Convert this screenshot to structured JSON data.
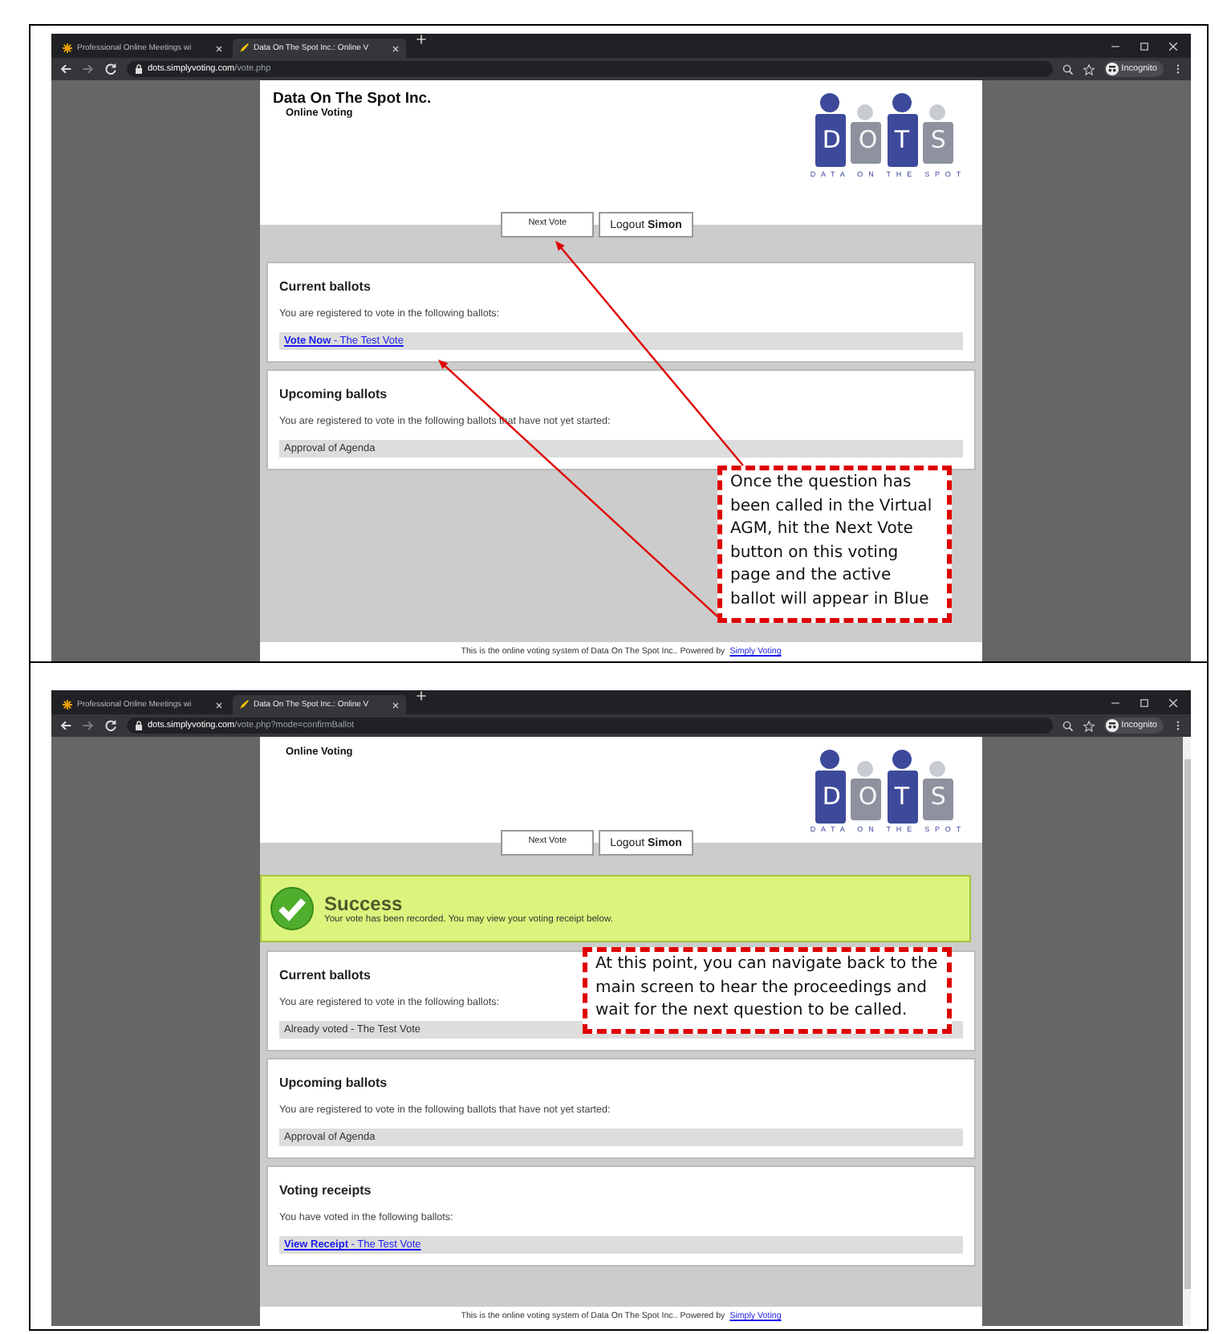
{
  "screenshots": [
    {
      "tabs": [
        {
          "title": "Professional Online Meetings wi",
          "selected": false
        },
        {
          "title": "Data On The Spot Inc.: Online V",
          "selected": true
        }
      ],
      "address": "**dots.simplyvoting.com**/vote.php",
      "profile": "Incognito",
      "header": {
        "org": "Data On The Spot Inc.",
        "subtitle": "Online Voting",
        "logo_letters": [
          "D",
          "O",
          "T",
          "S"
        ],
        "logo_tagline": "DATA ON THE SPOT"
      },
      "nav": [
        {
          "label": "Next Vote"
        },
        {
          "label": "Logout **Simon**"
        }
      ],
      "panels": [
        {
          "title": "Current ballots",
          "text": "You are registered to vote in the following ballots:",
          "items": [
            {
              "kind": "link",
              "text": "**Vote Now** - The Test Vote"
            }
          ]
        },
        {
          "title": "Upcoming ballots",
          "text": "You are registered to vote in the following ballots that have not yet started:",
          "items": [
            {
              "kind": "plain",
              "text": "Approval of Agenda"
            }
          ]
        }
      ],
      "footer": {
        "text": "This is the online voting system of Data On The Spot Inc.. Powered by",
        "link": "Simply Voting"
      },
      "callout": "Once the question has been called in the Virtual AGM, hit the Next Vote button on this voting page and the active ballot will appear in Blue",
      "scrollbar": false
    },
    {
      "tabs": [
        {
          "title": "Professional Online Meetings wi",
          "selected": false
        },
        {
          "title": "Data On The Spot Inc.: Online V",
          "selected": true
        }
      ],
      "address": "**dots.simplyvoting.com**/vote.php?mode=confirmBallot",
      "profile": "Incognito",
      "header": {
        "subtitle": "Online Voting",
        "logo_letters": [
          "D",
          "O",
          "T",
          "S"
        ],
        "logo_tagline": "DATA ON THE SPOT"
      },
      "nav": [
        {
          "label": "Next Vote"
        },
        {
          "label": "Logout **Simon**"
        }
      ],
      "alert": {
        "title": "Success",
        "message": "Your vote has been recorded. You may view your voting receipt below."
      },
      "panels": [
        {
          "title": "Current ballots",
          "text": "You are registered to vote in the following ballots:",
          "items": [
            {
              "kind": "plain",
              "text": "Already voted - The Test Vote"
            }
          ]
        },
        {
          "title": "Upcoming ballots",
          "text": "You are registered to vote in the following ballots that have not yet started:",
          "items": [
            {
              "kind": "plain",
              "text": "Approval of Agenda"
            }
          ]
        },
        {
          "title": "Voting receipts",
          "text": "You have voted in the following ballots:",
          "items": [
            {
              "kind": "link",
              "text": "**View Receipt** - The Test Vote"
            }
          ]
        }
      ],
      "footer": {
        "text": "This is the online voting system of Data On The Spot Inc.. Powered by",
        "link": "Simply Voting"
      },
      "callout": "At this point, you can navigate back to the main screen to hear the proceedings and wait for the next question to be called.",
      "scrollbar": true
    }
  ]
}
